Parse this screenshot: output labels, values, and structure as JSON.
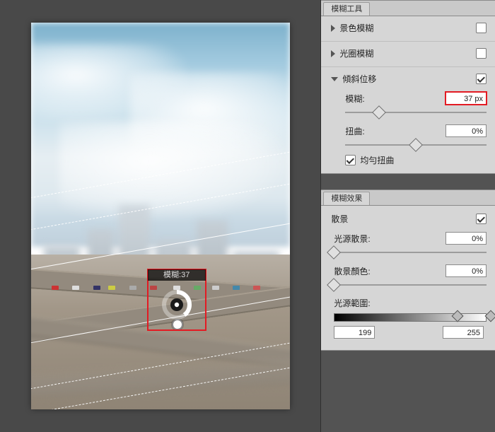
{
  "panels": {
    "tools": {
      "tab_label": "模糊工具"
    },
    "effects": {
      "tab_label": "模糊效果"
    }
  },
  "field_blur": {
    "label": "景色模糊",
    "expanded": false,
    "enabled": false
  },
  "iris_blur": {
    "label": "光圈模糊",
    "expanded": false,
    "enabled": false
  },
  "tilt_shift": {
    "label": "傾斜位移",
    "expanded": true,
    "enabled": true,
    "blur_label": "模糊:",
    "blur_value": "37 px",
    "blur_pct": 24,
    "distort_label": "扭曲:",
    "distort_value": "0%",
    "distort_pct": 50,
    "sym_label": "均勻扭曲",
    "sym_checked": true
  },
  "bokeh": {
    "label": "散景",
    "enabled": true,
    "light_label": "光源散景:",
    "light_value": "0%",
    "light_pct": 0,
    "color_label": "散景顏色:",
    "color_value": "0%",
    "color_pct": 0,
    "range_label": "光源範圍:",
    "range_lo": "199",
    "range_hi": "255",
    "range_lo_pct": 78,
    "range_hi_pct": 100
  },
  "overlay": {
    "label": "模糊:37"
  },
  "cars": [
    {
      "x": 8,
      "c": "#c33"
    },
    {
      "x": 16,
      "c": "#ddd"
    },
    {
      "x": 24,
      "c": "#336"
    },
    {
      "x": 30,
      "c": "#cc4"
    },
    {
      "x": 38,
      "c": "#aaa"
    },
    {
      "x": 46,
      "c": "#b44"
    },
    {
      "x": 55,
      "c": "#ddd"
    },
    {
      "x": 63,
      "c": "#6a6"
    },
    {
      "x": 70,
      "c": "#ccc"
    },
    {
      "x": 78,
      "c": "#48a"
    },
    {
      "x": 86,
      "c": "#c55"
    }
  ]
}
